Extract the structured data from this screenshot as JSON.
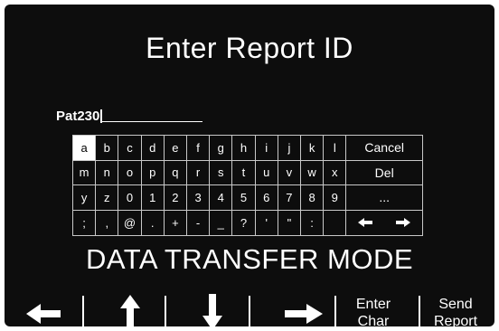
{
  "title": "Enter Report ID",
  "entry": {
    "value": "Pat230"
  },
  "keyboard": {
    "selected": "a",
    "rows": [
      [
        "a",
        "b",
        "c",
        "d",
        "e",
        "f",
        "g",
        "h",
        "i",
        "j",
        "k",
        "l",
        "Cancel"
      ],
      [
        "m",
        "n",
        "o",
        "p",
        "q",
        "r",
        "s",
        "t",
        "u",
        "v",
        "w",
        "x",
        "Del"
      ],
      [
        "y",
        "z",
        "0",
        "1",
        "2",
        "3",
        "4",
        "5",
        "6",
        "7",
        "8",
        "9",
        "..."
      ],
      [
        ";",
        ",",
        "@",
        ".",
        "+",
        "-",
        "_",
        "?",
        "'",
        "\"",
        ":",
        "",
        ""
      ]
    ],
    "cursor_keys": [
      "left-arrow-icon",
      "right-arrow-icon"
    ]
  },
  "mode_text": "DATA TRANSFER MODE",
  "softkeys": [
    {
      "type": "icon",
      "icon": "left-arrow-icon"
    },
    {
      "type": "icon",
      "icon": "up-arrow-icon"
    },
    {
      "type": "icon",
      "icon": "down-arrow-icon"
    },
    {
      "type": "icon",
      "icon": "right-arrow-icon"
    },
    {
      "type": "text",
      "line1": "Enter",
      "line2": "Char"
    },
    {
      "type": "text",
      "line1": "Send",
      "line2": "Report"
    }
  ]
}
